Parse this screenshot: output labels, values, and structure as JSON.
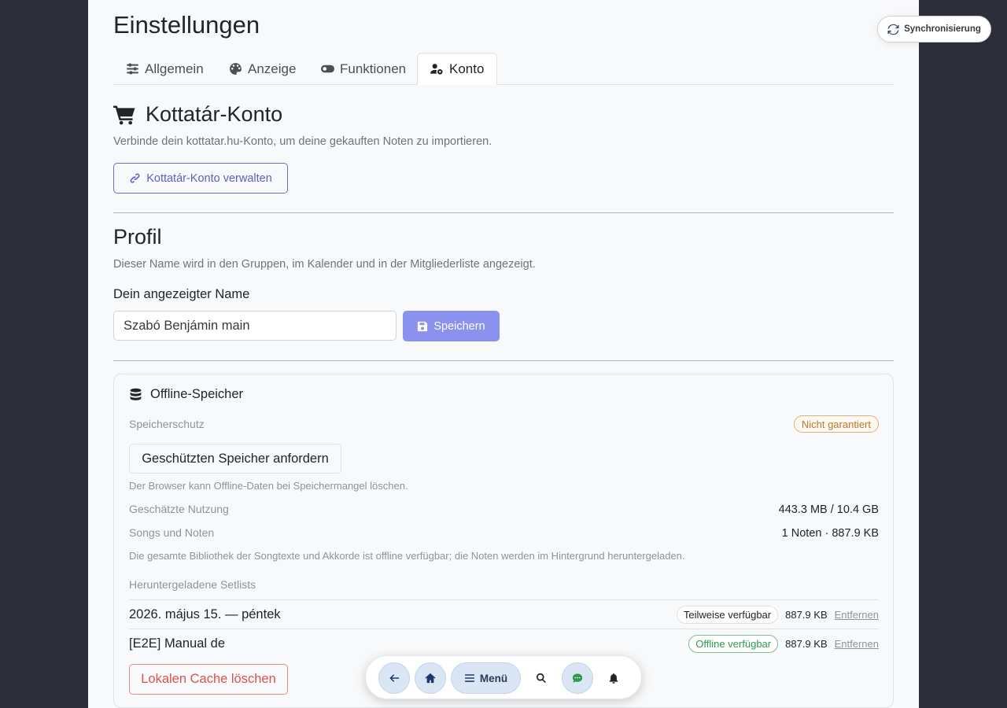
{
  "page": {
    "title": "Einstellungen",
    "tabs": [
      {
        "label": "Allgemein",
        "icon": "sliders-icon"
      },
      {
        "label": "Anzeige",
        "icon": "palette-icon"
      },
      {
        "label": "Funktionen",
        "icon": "toggle-icon"
      },
      {
        "label": "Konto",
        "icon": "user-gear-icon",
        "active": true
      }
    ]
  },
  "kottatar": {
    "title": "Kottatár-Konto",
    "description": "Verbinde dein kottatar.hu-Konto, um deine gekauften Noten zu importieren.",
    "manage_button": "Kottatár-Konto verwalten"
  },
  "profile": {
    "title": "Profil",
    "description": "Dieser Name wird in den Gruppen, im Kalender und in der Mitgliederliste angezeigt.",
    "name_label": "Dein angezeigter Name",
    "name_value": "Szabó Benjámin main",
    "save_button": "Speichern"
  },
  "offline": {
    "title": "Offline-Speicher",
    "protection_label": "Speicherschutz",
    "protection_badge": "Nicht garantiert",
    "request_button": "Geschützten Speicher anfordern",
    "browser_note": "Der Browser kann Offline-Daten bei Speichermangel löschen.",
    "usage_label": "Geschätzte Nutzung",
    "usage_value": "443.3 MB / 10.4 GB",
    "songs_label": "Songs und Noten",
    "songs_value": "1 Noten · 887.9 KB",
    "library_note": "Die gesamte Bibliothek der Songtexte und Akkorde ist offline verfügbar; die Noten werden im Hintergrund heruntergeladen.",
    "setlists_label": "Heruntergeladene Setlists",
    "setlists": [
      {
        "name": "2026. május 15. — péntek",
        "status": "Teilweise verfügbar",
        "size": "887.9 KB",
        "remove": "Entfernen"
      },
      {
        "name": "[E2E] Manual de",
        "status": "Offline verfügbar",
        "size": "887.9 KB",
        "remove": "Entfernen"
      }
    ],
    "clear_button": "Lokalen Cache löschen"
  },
  "sync": {
    "label": "Synchronisierung"
  },
  "dock": {
    "menu_label": "Menü"
  },
  "colors": {
    "accent": "#5d62c2",
    "save_bg": "#8b91ee",
    "danger": "#d9534f",
    "success": "#2f9a4f",
    "warning": "#b87a2a"
  }
}
